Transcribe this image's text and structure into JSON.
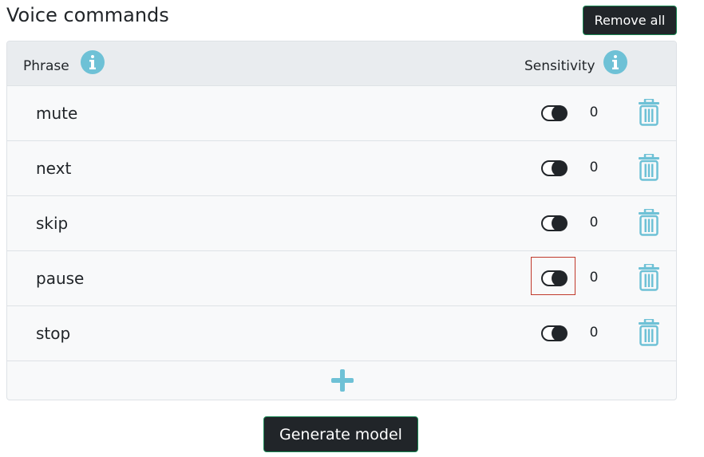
{
  "page": {
    "title": "Voice commands",
    "remove_all_label": "Remove all",
    "generate_label": "Generate model"
  },
  "table": {
    "header": {
      "phrase_label": "Phrase",
      "sensitivity_label": "Sensitivity"
    },
    "rows": [
      {
        "phrase": "mute",
        "sensitivity": "0"
      },
      {
        "phrase": "next",
        "sensitivity": "0"
      },
      {
        "phrase": "skip",
        "sensitivity": "0"
      },
      {
        "phrase": "pause",
        "sensitivity": "0"
      },
      {
        "phrase": "stop",
        "sensitivity": "0"
      }
    ]
  },
  "icons": {
    "info": "info-icon",
    "delete": "trash-icon",
    "add": "plus-icon"
  },
  "colors": {
    "accent": "#6ec1d6",
    "dark": "#212529",
    "button_border": "#198754",
    "focus_outline": "#c0392b"
  }
}
